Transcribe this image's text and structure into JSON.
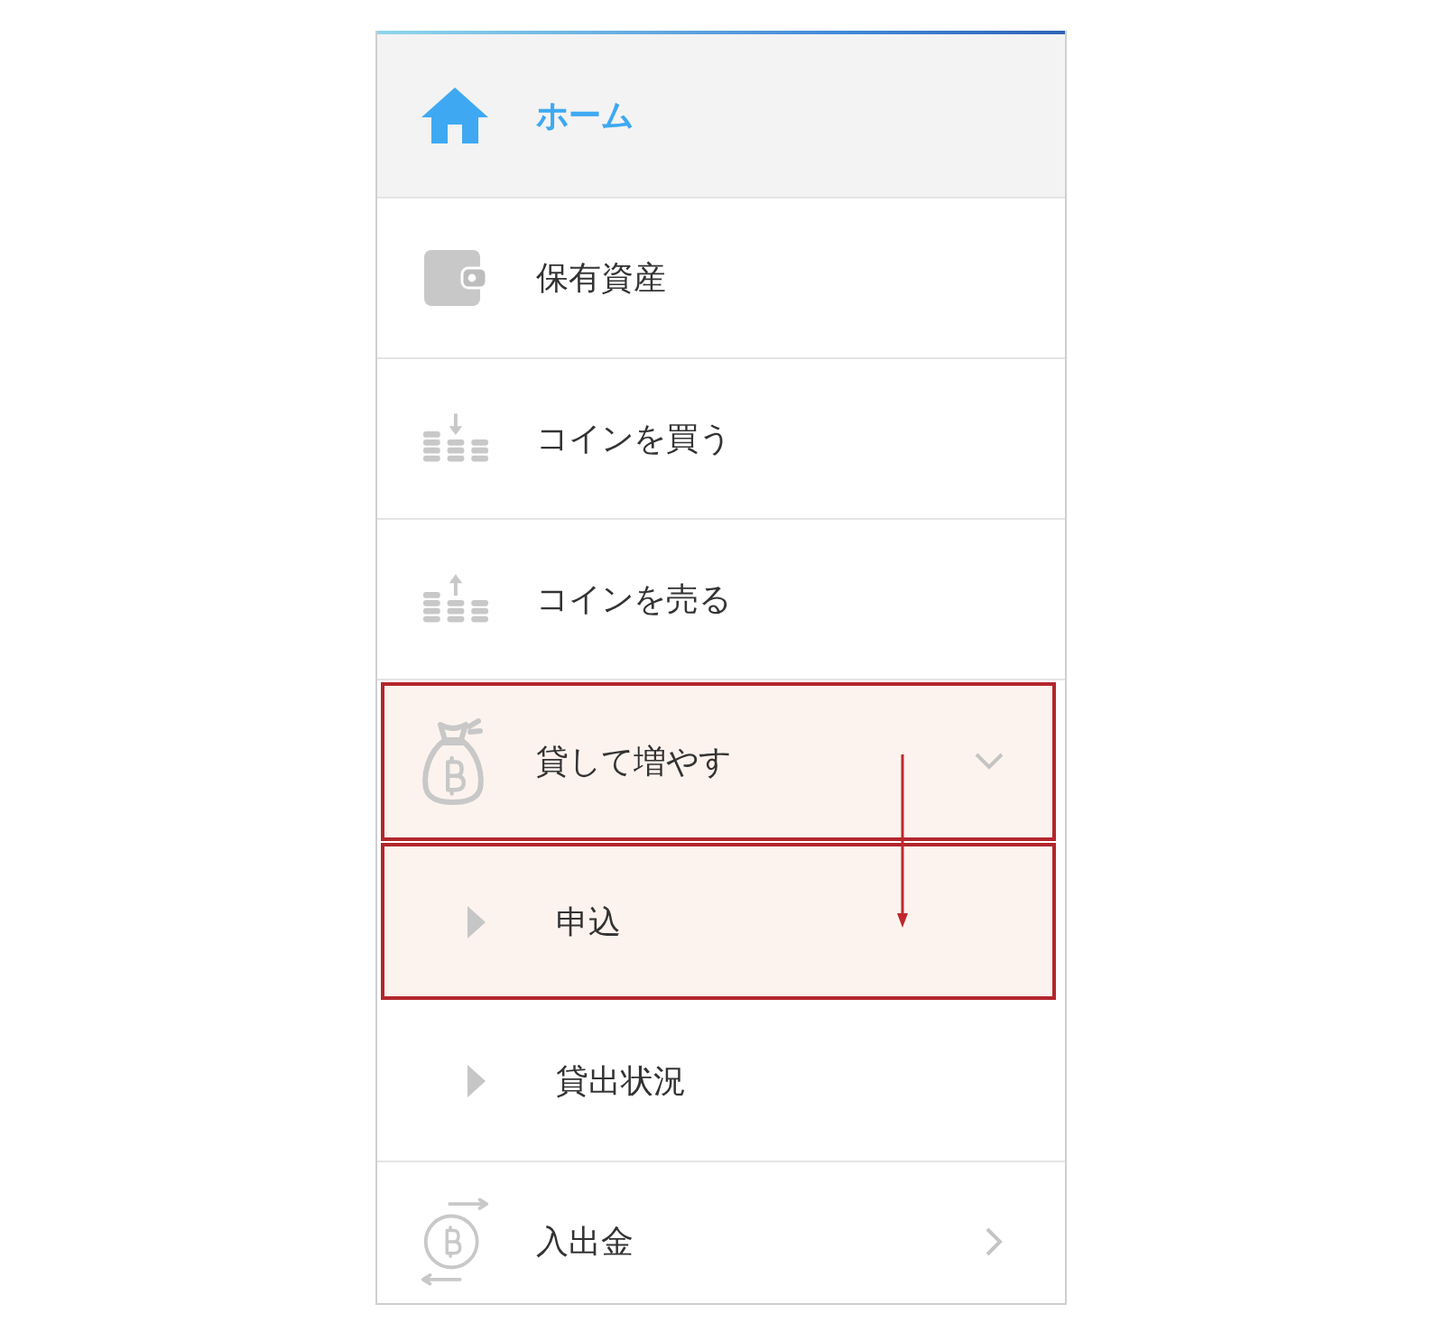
{
  "menu": {
    "items": [
      {
        "kind": "home",
        "label": "ホーム",
        "selected": true,
        "highlighted": false
      },
      {
        "kind": "wallet",
        "label": "保有資産",
        "selected": false,
        "highlighted": false
      },
      {
        "kind": "coins-in",
        "label": "コインを買う",
        "selected": false,
        "highlighted": false
      },
      {
        "kind": "coins-out",
        "label": "コインを売る",
        "selected": false,
        "highlighted": false
      },
      {
        "kind": "money-bag",
        "label": "貸して増やす",
        "selected": false,
        "highlighted": true,
        "expanded": true,
        "children": [
          {
            "label": "申込",
            "selected": false,
            "highlighted": true
          },
          {
            "label": "貸出状況",
            "selected": false,
            "highlighted": false
          }
        ]
      },
      {
        "kind": "transfer",
        "label": "入出金",
        "selected": false,
        "highlighted": false,
        "expanded": false
      }
    ]
  },
  "callout_arrow": true
}
